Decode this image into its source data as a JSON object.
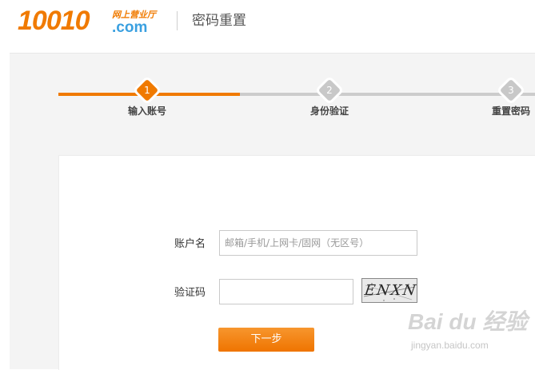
{
  "header": {
    "logo_number": "10010",
    "logo_top": "网上营业厅",
    "logo_bottom": ".com",
    "title": "密码重置"
  },
  "steps": [
    {
      "num": "1",
      "label": "输入账号",
      "state": "active"
    },
    {
      "num": "2",
      "label": "身份验证",
      "state": "inactive"
    },
    {
      "num": "3",
      "label": "重置密码",
      "state": "inactive"
    }
  ],
  "form": {
    "account_label": "账户名",
    "account_placeholder": "邮箱/手机/上网卡/固网（无区号）",
    "account_value": "",
    "captcha_label": "验证码",
    "captcha_value": "",
    "captcha_image_text": "ENXN",
    "next_button": "下一步"
  },
  "watermark": {
    "main": "Bai du 经验",
    "sub": "jingyan.baidu.com"
  },
  "colors": {
    "accent": "#f07a00",
    "logo_blue": "#3aa0e0",
    "inactive": "#cccccc",
    "panel_bg": "#f4f4f4"
  }
}
